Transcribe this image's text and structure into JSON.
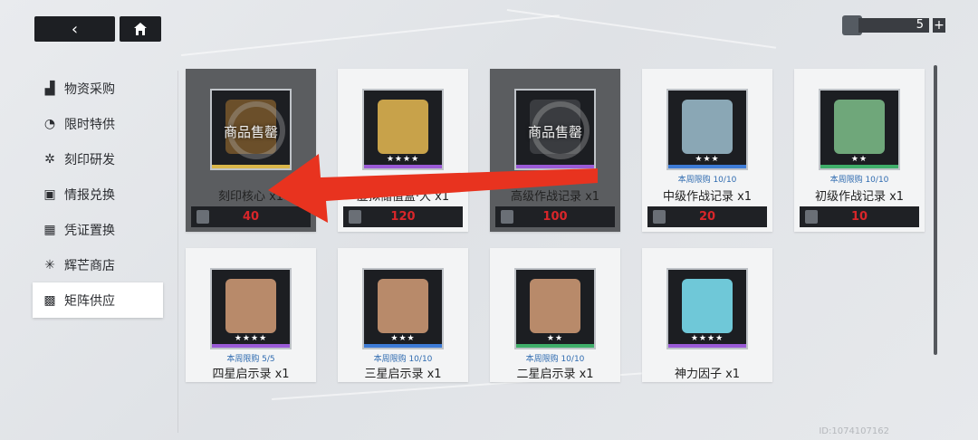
{
  "topbar": {
    "back_icon": "chevron-left-icon",
    "home_icon": "home-icon",
    "currency_value": "5",
    "currency_add": "+"
  },
  "sidebar": {
    "items": [
      {
        "label": "物资采购",
        "icon": "crate-icon",
        "active": false
      },
      {
        "label": "限时特供",
        "icon": "clock-badge-icon",
        "active": false
      },
      {
        "label": "刻印研发",
        "icon": "gear-badge-icon",
        "active": false
      },
      {
        "label": "情报兑换",
        "icon": "id-card-icon",
        "active": false
      },
      {
        "label": "凭证置换",
        "icon": "voucher-icon",
        "active": false
      },
      {
        "label": "辉芒商店",
        "icon": "sparkle-icon",
        "active": false
      },
      {
        "label": "矩阵供应",
        "icon": "matrix-icon",
        "active": true
      }
    ]
  },
  "items": [
    {
      "name": "刻印核心 x1",
      "price": "40",
      "sold_out": true,
      "sold_label": "商品售罄",
      "limit": "",
      "stars": "",
      "rarity_color": "#d9b64a"
    },
    {
      "name": "虚拟储值盒·大 x1",
      "price": "120",
      "sold_out": false,
      "sold_label": "",
      "limit": "",
      "stars": "★★★★",
      "rarity_color": "#9a5ad6"
    },
    {
      "name": "高级作战记录 x1",
      "price": "100",
      "sold_out": true,
      "sold_label": "商品售罄",
      "limit": "",
      "stars": "",
      "rarity_color": "#9a5ad6"
    },
    {
      "name": "中级作战记录 x1",
      "price": "20",
      "sold_out": false,
      "sold_label": "",
      "limit": "本周限购 10/10",
      "stars": "★★★",
      "rarity_color": "#3d7bd6"
    },
    {
      "name": "初级作战记录 x1",
      "price": "10",
      "sold_out": false,
      "sold_label": "",
      "limit": "本周限购 10/10",
      "stars": "★★",
      "rarity_color": "#3fae6a"
    },
    {
      "name": "四星启示录 x1",
      "price": "",
      "sold_out": false,
      "sold_label": "",
      "limit": "本周限购 5/5",
      "stars": "★★★★",
      "rarity_color": "#9a5ad6"
    },
    {
      "name": "三星启示录 x1",
      "price": "",
      "sold_out": false,
      "sold_label": "",
      "limit": "本周限购 10/10",
      "stars": "★★★",
      "rarity_color": "#3d7bd6"
    },
    {
      "name": "二星启示录 x1",
      "price": "",
      "sold_out": false,
      "sold_label": "",
      "limit": "本周限购 10/10",
      "stars": "★★",
      "rarity_color": "#3fae6a"
    },
    {
      "name": "神力因子 x1",
      "price": "",
      "sold_out": false,
      "sold_label": "",
      "limit": "",
      "stars": "★★★★",
      "rarity_color": "#9a5ad6"
    }
  ],
  "annotation": {
    "arrow_color": "#e8331f"
  },
  "footer": {
    "uid": "ID:1074107162"
  }
}
